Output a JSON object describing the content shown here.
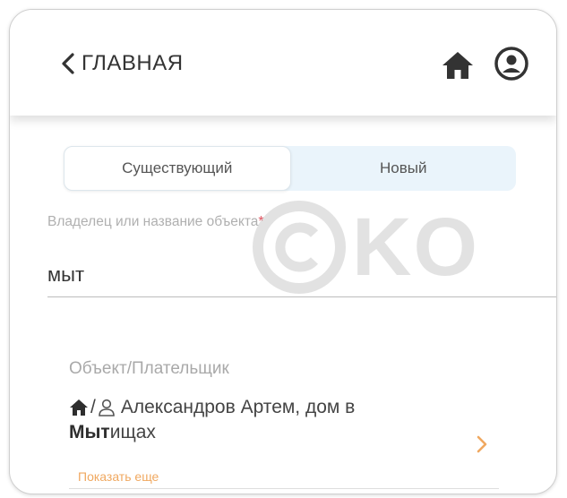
{
  "header": {
    "back_label": "ГЛАВНАЯ",
    "back_icon": "chevron-left-icon",
    "home_icon": "home-icon",
    "profile_icon": "account-circle-icon"
  },
  "toggle": {
    "existing_label": "Существующий",
    "new_label": "Новый",
    "selected": "Существующий"
  },
  "search": {
    "label": "Владелец или название объекта",
    "required_mark": "*",
    "value": "мыт"
  },
  "watermark": {
    "text": "KO"
  },
  "results": {
    "title": "Объект/Плательщик",
    "items": [
      {
        "text_before": "Александров Артем, дом в",
        "highlight": "Мыт",
        "text_after": "ищах",
        "icons": [
          "home-icon",
          "person-icon"
        ],
        "separator": "/"
      }
    ],
    "show_more_label": "Показать еще"
  },
  "colors": {
    "accent": "#f0a860",
    "toggle_bg": "#eaf4fb",
    "required": "#e0525f"
  }
}
